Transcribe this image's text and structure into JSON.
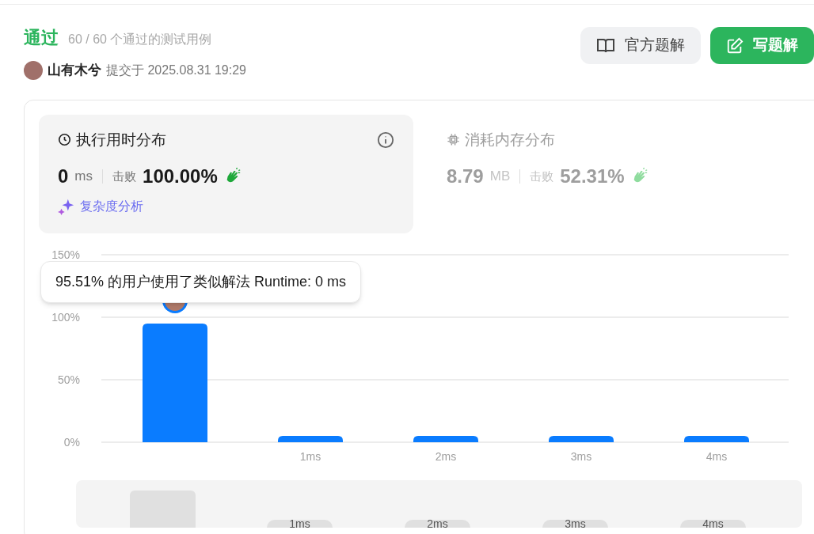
{
  "result": {
    "status": "通过",
    "cases_text": "60 / 60 个通过的测试用例"
  },
  "submission": {
    "user": "山有木兮",
    "submitted_text": "提交于 2025.08.31 19:29"
  },
  "buttons": [
    {
      "label": "官方题解",
      "kind": "secondary"
    },
    {
      "label": "写题解",
      "kind": "primary"
    }
  ],
  "stats": [
    {
      "kind": "runtime",
      "title": "执行用时分布",
      "selected": true,
      "value": "0",
      "unit": "ms",
      "beats_label": "击败",
      "beats": "100.00%",
      "link": "复杂度分析"
    },
    {
      "kind": "memory",
      "title": "消耗内存分布",
      "selected": false,
      "value": "8.79",
      "unit": "MB",
      "beats_label": "击败",
      "beats": "52.31%"
    }
  ],
  "chart": {
    "tooltip": "95.51% 的用户使用了类似解法 Runtime: 0 ms",
    "chart_data": {
      "type": "bar",
      "categories": [
        null,
        "1ms",
        "2ms",
        "3ms",
        "4ms"
      ],
      "series": [
        {
          "color": "#0a7cff",
          "values": [
            95,
            5,
            5,
            5,
            5
          ]
        }
      ],
      "ylim": [
        0,
        150
      ],
      "yticks": [
        {
          "value": 0,
          "label": "0%"
        },
        {
          "value": 50,
          "label": "50%"
        },
        {
          "value": 100,
          "label": "100%"
        },
        {
          "value": 150,
          "label": "150%"
        }
      ]
    },
    "brush_labels": [
      "1ms",
      "2ms",
      "3ms",
      "4ms"
    ]
  }
}
